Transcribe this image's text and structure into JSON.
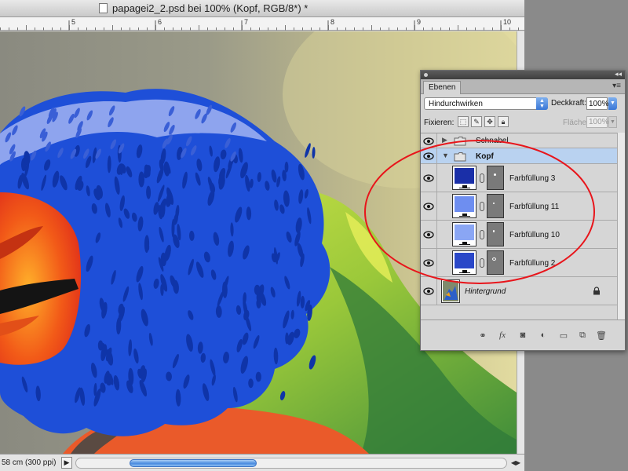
{
  "document": {
    "title": "papagei2_2.psd bei 100% (Kopf, RGB/8*) *",
    "status_text": "58 cm (300 ppi)",
    "ruler_numbers": [
      "5",
      "6",
      "7",
      "8",
      "9",
      "10"
    ]
  },
  "layers_panel": {
    "tab_label": "Ebenen",
    "blend_mode": "Hindurchwirken",
    "opacity_label": "Deckkraft:",
    "opacity_value": "100%",
    "lock_label": "Fixieren:",
    "fill_label": "Fläche:",
    "fill_value": "100%",
    "layers": [
      {
        "name": "Schnabel",
        "type": "group",
        "expanded": false,
        "selected": false
      },
      {
        "name": "Kopf",
        "type": "group",
        "expanded": true,
        "selected": true
      },
      {
        "name": "Farbfüllung 3",
        "type": "fill",
        "color": "#1a2fa8",
        "selected": false
      },
      {
        "name": "Farbfüllung 11",
        "type": "fill",
        "color": "#6e8ef0",
        "selected": false
      },
      {
        "name": "Farbfüllung 10",
        "type": "fill",
        "color": "#8aa6f4",
        "selected": false
      },
      {
        "name": "Farbfüllung 2",
        "type": "fill",
        "color": "#2a47c8",
        "selected": false
      },
      {
        "name": "Hintergrund",
        "type": "background",
        "locked": true,
        "selected": false
      }
    ],
    "icons": [
      "eye-icon",
      "folder-icon",
      "chain-link-icon",
      "lock-icon",
      "link-layers-icon",
      "fx-icon",
      "add-mask-icon",
      "adjustment-layer-icon",
      "new-group-icon",
      "new-layer-icon",
      "trash-icon"
    ]
  },
  "colors": {
    "annotation": "#e8151b",
    "feather_blue": "#1e4fd8",
    "feather_light": "#8ea4ee",
    "beak_orange": "#f04a1a",
    "selection": "#b9d2f0"
  }
}
